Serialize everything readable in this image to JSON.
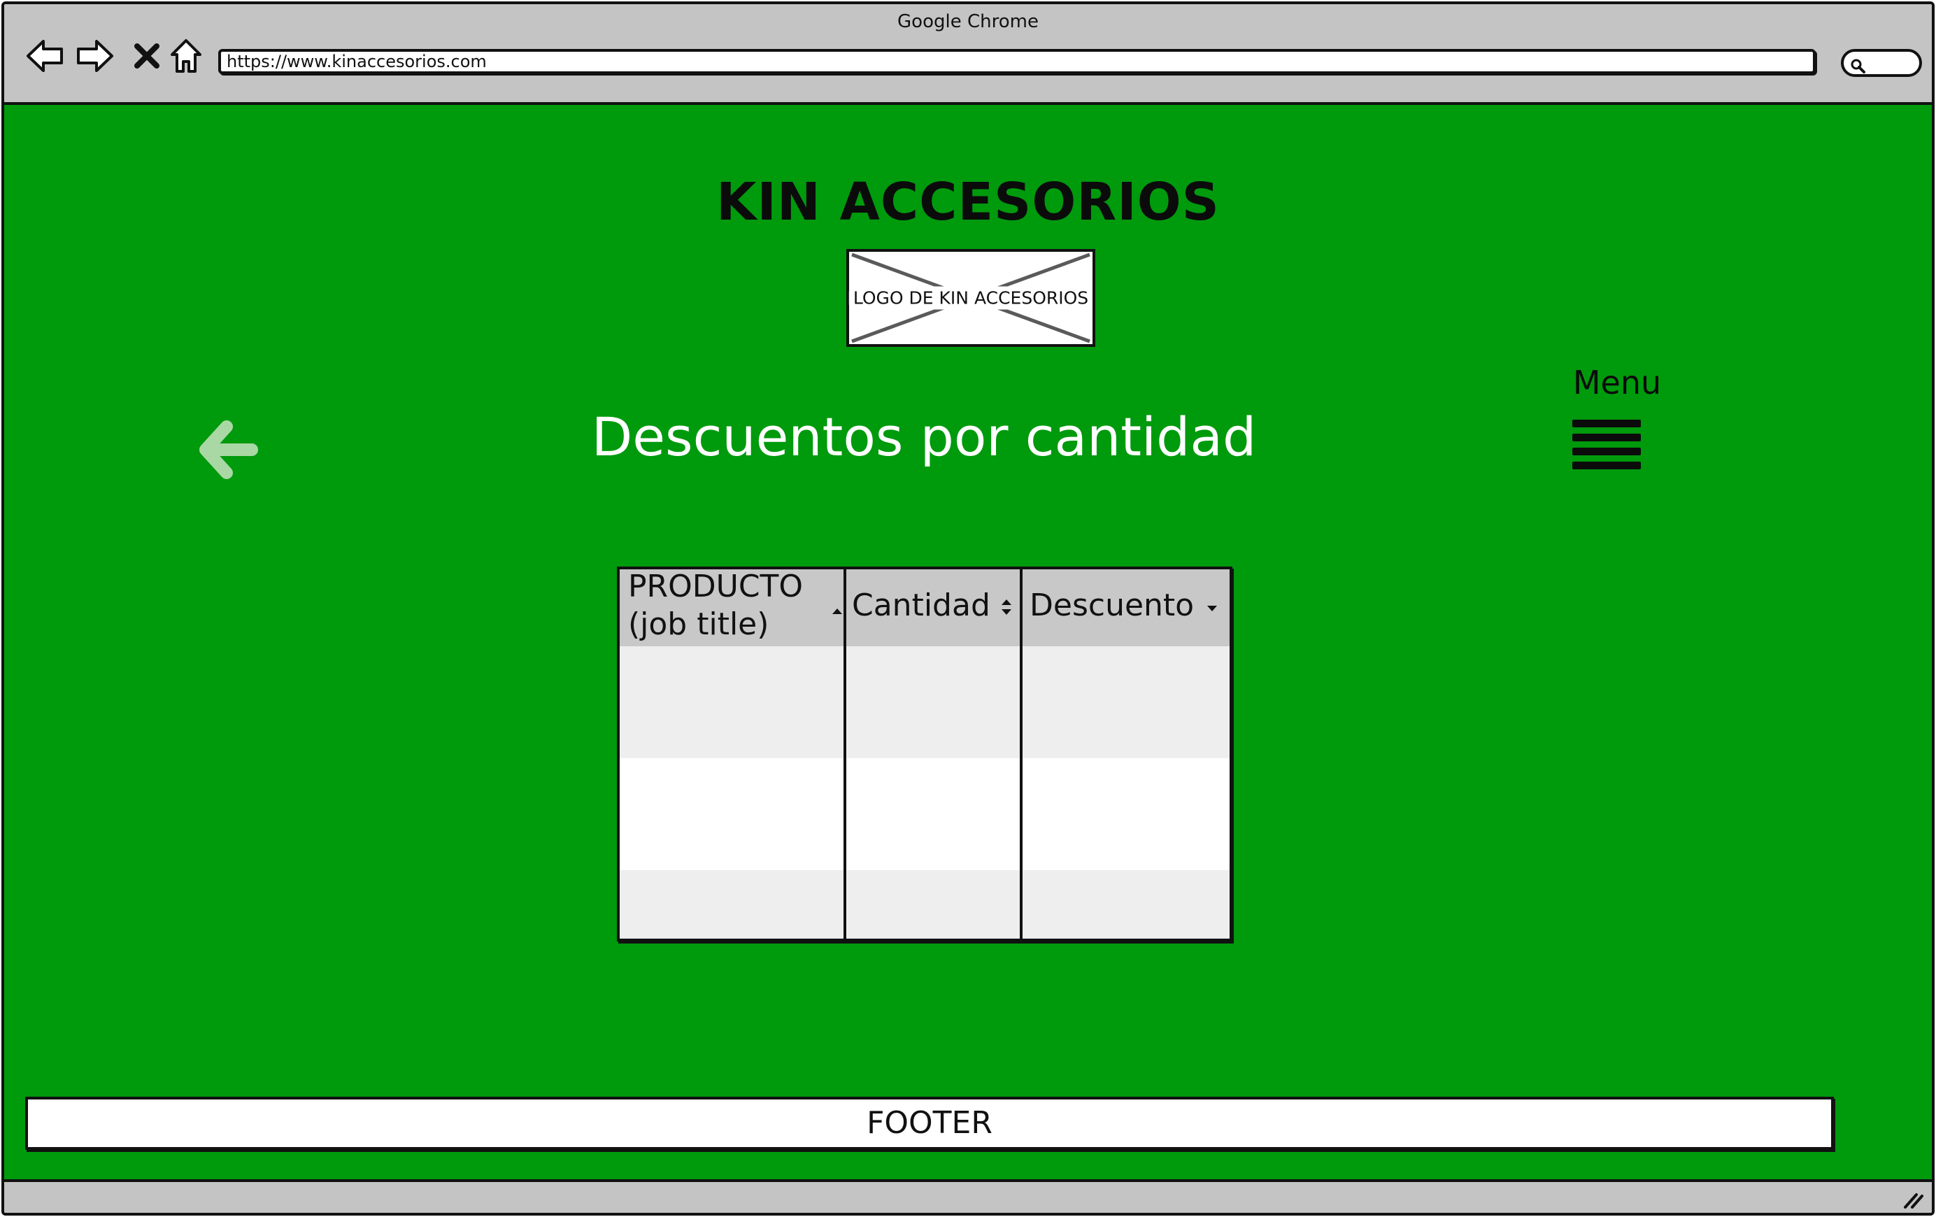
{
  "browser": {
    "window_title": "Google Chrome",
    "url": "https://www.kinaccesorios.com",
    "icons": [
      "back-arrow-icon",
      "forward-arrow-icon",
      "close-icon",
      "home-icon",
      "search-icon"
    ]
  },
  "header": {
    "brand": "KIN ACCESORIOS",
    "logo_placeholder": "LOGO DE KIN ACCESORIOS"
  },
  "page": {
    "title": "Descuentos por cantidad",
    "menu_label": "Menu",
    "back_icon": "left-arrow-icon",
    "menu_icon": "hamburger-icon"
  },
  "table": {
    "columns": [
      {
        "line1": "PRODUCTO",
        "line2": "(job title)",
        "sort": "ascending"
      },
      {
        "label": "Cantidad",
        "sort": "both"
      },
      {
        "label": "Descuento",
        "sort": "descending"
      }
    ],
    "rows": [
      [
        "",
        "",
        ""
      ],
      [
        "",
        "",
        ""
      ],
      [
        "",
        "",
        ""
      ]
    ]
  },
  "footer": {
    "label": "FOOTER"
  },
  "colors": {
    "page_background": "#009a0d",
    "chrome_gray": "#c4c4c4",
    "title_text": "#ffffff",
    "back_arrow": "#a9d8a4"
  }
}
